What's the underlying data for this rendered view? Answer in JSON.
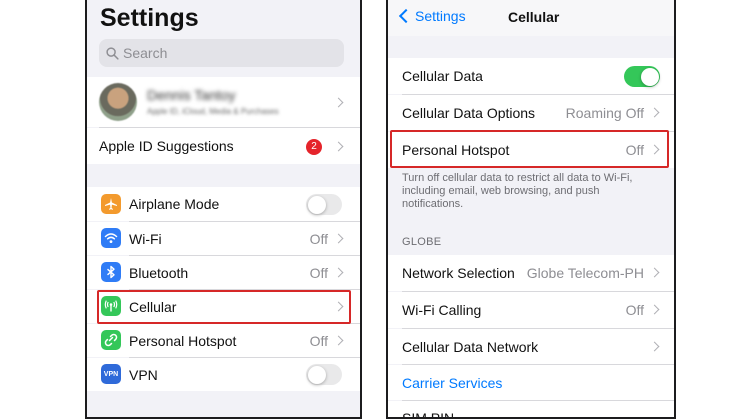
{
  "left": {
    "title": "Settings",
    "search": {
      "placeholder": "Search"
    },
    "profile": {
      "name": "Dennis Tantoy",
      "subtitle": "Apple ID, iCloud, Media & Purchases"
    },
    "suggestions": {
      "label": "Apple ID Suggestions",
      "badge": "2"
    },
    "items": [
      {
        "label": "Airplane Mode",
        "icon": "airplane-icon",
        "color": "#f39a2d",
        "control": "toggle-off"
      },
      {
        "label": "Wi-Fi",
        "icon": "wifi-icon",
        "color": "#2f7cf6",
        "value": "Off"
      },
      {
        "label": "Bluetooth",
        "icon": "bluetooth-icon",
        "color": "#2f7cf6",
        "value": "Off"
      },
      {
        "label": "Cellular",
        "icon": "antenna-icon",
        "color": "#34c759"
      },
      {
        "label": "Personal Hotspot",
        "icon": "hotspot-icon",
        "color": "#34c759",
        "value": "Off"
      },
      {
        "label": "VPN",
        "icon": "vpn-icon",
        "color": "#2f6ad9",
        "icon_text": "VPN",
        "control": "toggle-off"
      }
    ]
  },
  "right": {
    "nav": {
      "back_label": "Settings",
      "title": "Cellular"
    },
    "rows_top": [
      {
        "label": "Cellular Data",
        "control": "toggle-on"
      },
      {
        "label": "Cellular Data Options",
        "value": "Roaming Off"
      },
      {
        "label": "Personal Hotspot",
        "value": "Off"
      }
    ],
    "footer_note": "Turn off cellular data to restrict all data to Wi-Fi, including email, web browsing, and push notifications.",
    "section_header": "GLOBE",
    "rows_bottom": [
      {
        "label": "Network Selection",
        "value": "Globe Telecom-PH"
      },
      {
        "label": "Wi-Fi Calling",
        "value": "Off"
      },
      {
        "label": "Cellular Data Network"
      },
      {
        "label": "Carrier Services",
        "link": true
      },
      {
        "label": "SIM PIN"
      }
    ]
  },
  "colors": {
    "accent": "#007aff",
    "highlight": "#d62828",
    "toggle_on": "#34c759",
    "badge": "#e5242b"
  }
}
